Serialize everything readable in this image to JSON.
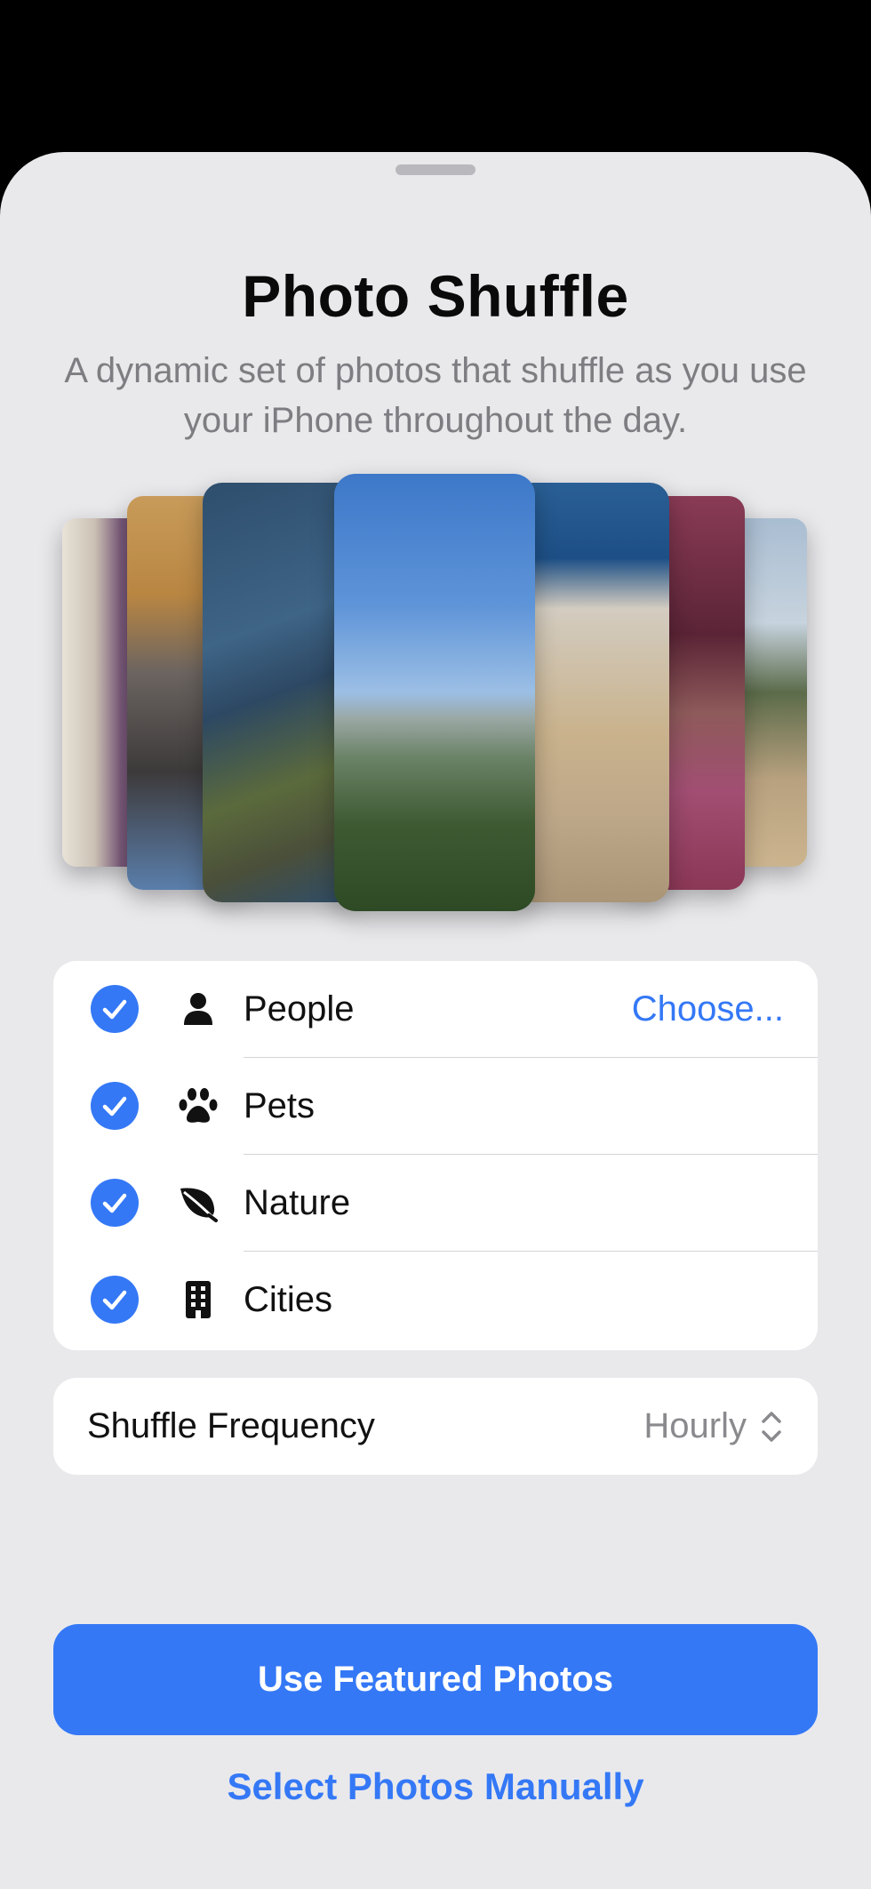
{
  "sheet": {
    "title": "Photo Shuffle",
    "subtitle": "A dynamic set of photos that shuffle as you use your iPhone throughout the day."
  },
  "categories": [
    {
      "label": "People",
      "checked": true,
      "icon": "person-icon",
      "action": "Choose..."
    },
    {
      "label": "Pets",
      "checked": true,
      "icon": "paw-icon"
    },
    {
      "label": "Nature",
      "checked": true,
      "icon": "leaf-icon"
    },
    {
      "label": "Cities",
      "checked": true,
      "icon": "building-icon"
    }
  ],
  "frequency": {
    "label": "Shuffle Frequency",
    "value": "Hourly"
  },
  "buttons": {
    "primary": "Use Featured Photos",
    "secondary": "Select Photos Manually"
  },
  "colors": {
    "accent": "#3478f6",
    "sheet_background": "#e9e9ec"
  }
}
